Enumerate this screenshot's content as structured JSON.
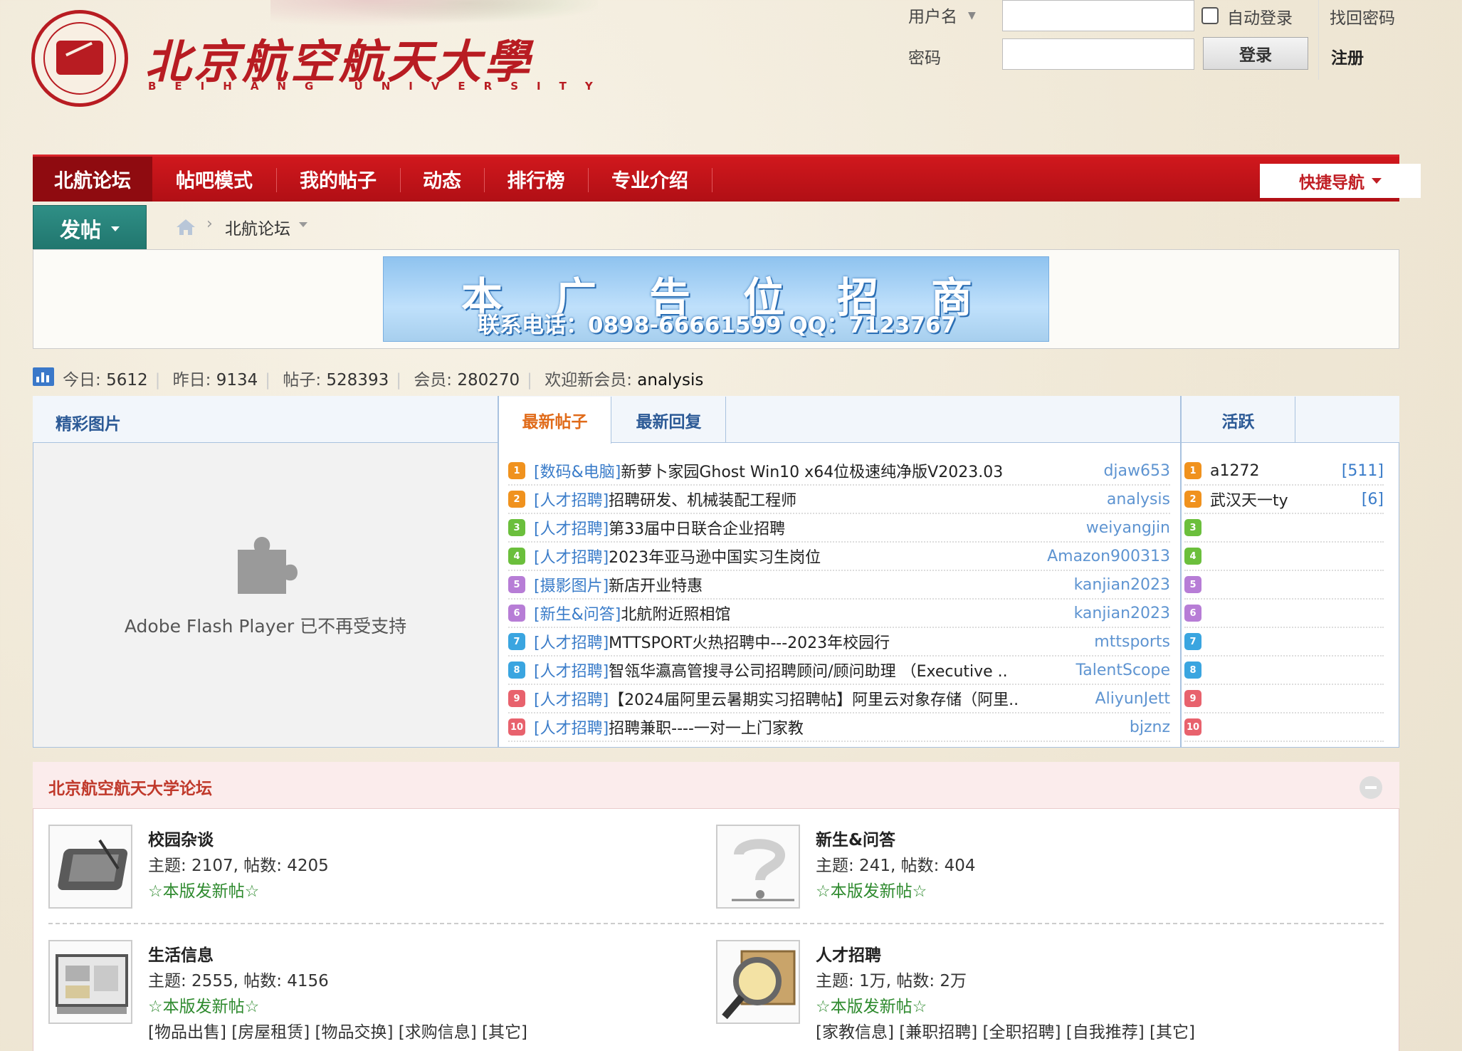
{
  "header": {
    "logo_cn": "北京航空航天大學",
    "logo_en": "BEIHANG UNIVERSITY"
  },
  "login": {
    "username_label": "用户名",
    "password_label": "密码",
    "auto_login_label": "自动登录",
    "login_button": "登录",
    "forgot_password": "找回密码",
    "register": "注册"
  },
  "nav": {
    "items": [
      "北航论坛",
      "帖吧模式",
      "我的帖子",
      "动态",
      "排行榜",
      "专业介绍"
    ],
    "quick_nav": "快捷导航"
  },
  "toolbar": {
    "post_button": "发帖",
    "breadcrumb_current": "北航论坛"
  },
  "ad": {
    "title": "本广告位招商",
    "contact": "联系电话：0898-66661599  QQ：7123767"
  },
  "stats": {
    "today_label": "今日:",
    "today_value": "5612",
    "yesterday_label": "昨日:",
    "yesterday_value": "9134",
    "posts_label": "帖子:",
    "posts_value": "528393",
    "members_label": "会员:",
    "members_value": "280270",
    "welcome_label": "欢迎新会员:",
    "welcome_user": "analysis"
  },
  "panel": {
    "photos_header": "精彩图片",
    "tab_latest": "最新帖子",
    "tab_reply": "最新回复",
    "tab_active": "活跃",
    "flash_message": "Adobe Flash Player 已不再受支持",
    "posts": [
      {
        "rank": "1",
        "category": "[数码&电脑]",
        "title": "新萝卜家园Ghost Win10 x64位极速纯净版V2023.03",
        "author": "djaw653"
      },
      {
        "rank": "2",
        "category": "[人才招聘]",
        "title": "招聘研发、机械装配工程师",
        "author": "analysis"
      },
      {
        "rank": "3",
        "category": "[人才招聘]",
        "title": "第33届中日联合企业招聘",
        "author": "weiyangjin"
      },
      {
        "rank": "4",
        "category": "[人才招聘]",
        "title": "2023年亚马逊中国实习生岗位",
        "author": "Amazon900313"
      },
      {
        "rank": "5",
        "category": "[摄影图片]",
        "title": "新店开业特惠",
        "author": "kanjian2023"
      },
      {
        "rank": "6",
        "category": "[新生&问答]",
        "title": "北航附近照相馆",
        "author": "kanjian2023"
      },
      {
        "rank": "7",
        "category": "[人才招聘]",
        "title": "MTTSPORT火热招聘中---2023年校园行",
        "author": "mttsports"
      },
      {
        "rank": "8",
        "category": "[人才招聘]",
        "title": "智瓴华瀛高管搜寻公司招聘顾问/顾问助理 （Executive ..",
        "author": "TalentScope"
      },
      {
        "rank": "9",
        "category": "[人才招聘]",
        "title": "【2024届阿里云暑期实习招聘帖】阿里云对象存储（阿里..",
        "author": "AliyunJett"
      },
      {
        "rank": "10",
        "category": "[人才招聘]",
        "title": "招聘兼职----一对一上门家教",
        "author": "bjznz"
      }
    ],
    "active_users": [
      {
        "rank": "1",
        "name": "a1272",
        "count": "[511]"
      },
      {
        "rank": "2",
        "name": "武汉天一ty",
        "count": "[6]"
      },
      {
        "rank": "3",
        "name": "",
        "count": ""
      },
      {
        "rank": "4",
        "name": "",
        "count": ""
      },
      {
        "rank": "5",
        "name": "",
        "count": ""
      },
      {
        "rank": "6",
        "name": "",
        "count": ""
      },
      {
        "rank": "7",
        "name": "",
        "count": ""
      },
      {
        "rank": "8",
        "name": "",
        "count": ""
      },
      {
        "rank": "9",
        "name": "",
        "count": ""
      },
      {
        "rank": "10",
        "name": "",
        "count": ""
      }
    ],
    "rank_colors": [
      "#f0921e",
      "#f0921e",
      "#6bbf3c",
      "#6bbf3c",
      "#b77dd6",
      "#b77dd6",
      "#3aa5e0",
      "#3aa5e0",
      "#e8626d",
      "#e8626d"
    ]
  },
  "forum": {
    "section_title": "北京航空航天大学论坛",
    "boards": [
      {
        "name": "校园杂谈",
        "stats": "主题: 2107, 帖数: 4205",
        "new_posts": "☆本版发新帖☆",
        "subs": "",
        "icon": "tablet-icon"
      },
      {
        "name": "新生&问答",
        "stats": "主题: 241, 帖数: 404",
        "new_posts": "☆本版发新帖☆",
        "subs": "",
        "icon": "question-mark-icon"
      },
      {
        "name": "生活信息",
        "stats": "主题: 2555, 帖数: 4156",
        "new_posts": "☆本版发新帖☆",
        "subs": "[物品出售] [房屋租赁] [物品交换] [求购信息] [其它]",
        "icon": "bulletin-icon"
      },
      {
        "name": "人才招聘",
        "stats": "主题: 1万, 帖数: 2万",
        "new_posts": "☆本版发新帖☆",
        "subs": "[家教信息] [兼职招聘] [全职招聘] [自我推荐] [其它]",
        "icon": "magnifier-icon"
      }
    ]
  }
}
